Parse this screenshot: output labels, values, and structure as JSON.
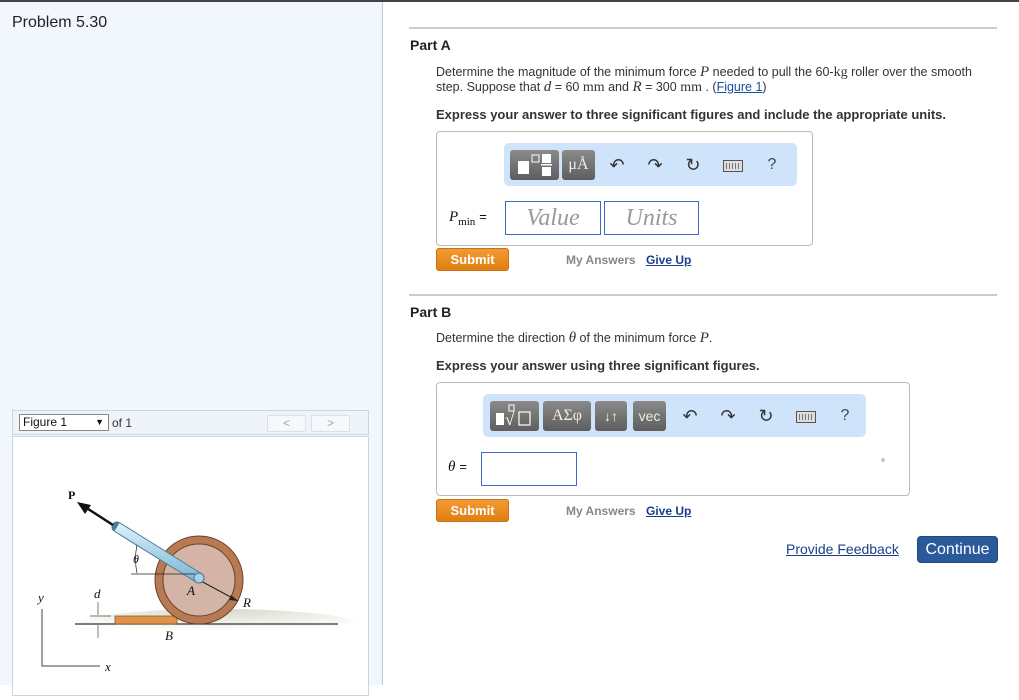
{
  "problem": {
    "title": "Problem 5.30"
  },
  "figure_viewer": {
    "selected": "Figure 1",
    "of_label": "of 1",
    "prev_glyph": "<",
    "next_glyph": ">",
    "labels": {
      "P": "P",
      "theta": "θ",
      "A": "A",
      "R": "R",
      "d": "d",
      "B": "B",
      "y": "y",
      "x": "x"
    }
  },
  "part_a": {
    "title": "Part A",
    "question": {
      "t1": "Determine the magnitude of the minimum force ",
      "var_P": "P",
      "t2": " needed to pull the 60-",
      "unit_kg": "kg",
      "t3": " roller over the smooth step. Suppose that ",
      "var_d": "d",
      "t4": " = 60 ",
      "unit_mm1": "mm",
      "t5": " and ",
      "var_R": "R",
      "t6": " = 300 ",
      "unit_mm2": "mm",
      "t7": " . (",
      "figure_link": "Figure 1",
      "t8": ")"
    },
    "instruction": "Express your answer to three significant figures and include the appropriate units.",
    "toolbar": {
      "template_btn": "template-icon",
      "units_btn": "μÅ",
      "undo": "↶",
      "redo": "↷",
      "reset": "↻",
      "help": "?"
    },
    "answer_label_var": "P",
    "answer_label_sub": "min",
    "equals": "=",
    "value_placeholder": "Value",
    "units_placeholder": "Units",
    "submit": "Submit",
    "my_answers": "My Answers",
    "give_up": "Give Up"
  },
  "part_b": {
    "title": "Part B",
    "question": {
      "t1": "Determine the direction ",
      "var_theta": "θ",
      "t2": " of the minimum force ",
      "var_P": "P",
      "t3": "."
    },
    "instruction": "Express your answer using three significant figures.",
    "toolbar": {
      "root_btn": "root-template-icon",
      "greek_btn": "ΑΣφ",
      "arrows_btn": "↓↑",
      "vec_btn": "vec",
      "undo": "↶",
      "redo": "↷",
      "reset": "↻",
      "help": "?"
    },
    "answer_label_var": "θ",
    "equals": "=",
    "value": "",
    "unit_suffix": "°",
    "submit": "Submit",
    "my_answers": "My Answers",
    "give_up": "Give Up"
  },
  "footer": {
    "provide_feedback": "Provide Feedback",
    "continue": "Continue"
  }
}
